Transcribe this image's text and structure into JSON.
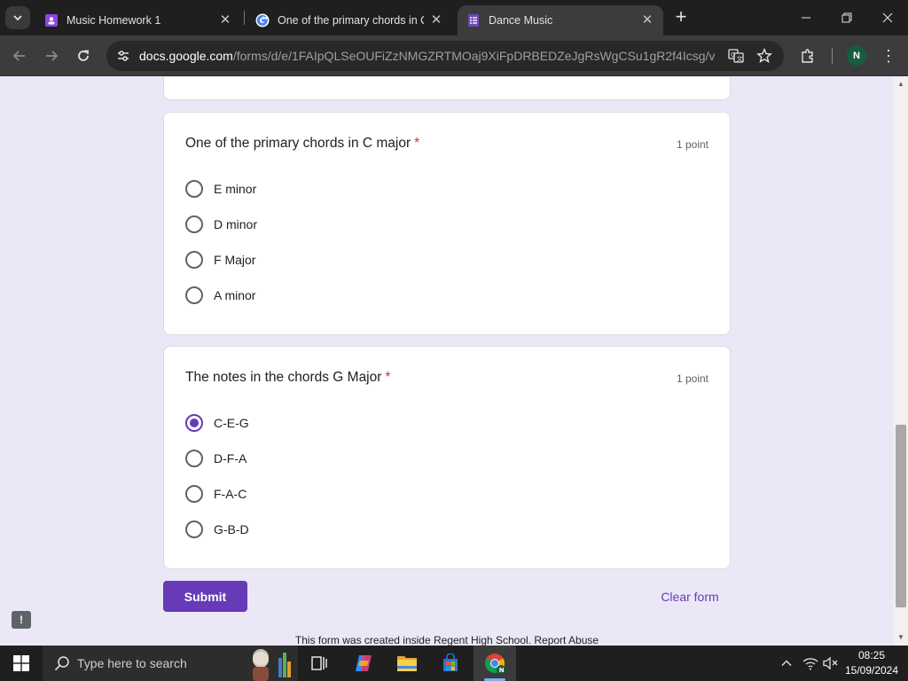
{
  "browser": {
    "tabs": [
      {
        "title": "Music Homework 1",
        "icon": "google-classroom-icon",
        "active": false
      },
      {
        "title": "One of the primary chords in C",
        "icon": "google-icon",
        "active": false
      },
      {
        "title": "Dance Music",
        "icon": "google-forms-icon",
        "active": true
      }
    ],
    "url_host": "docs.google.com",
    "url_path": "/forms/d/e/1FAIpQLSeOUFiZzNMGZRTMOaj9XiFpDRBEDZeJgRsWgCSu1gR2f4Icsg/viewf...",
    "profile_initial": "N",
    "colors": {
      "frame": "#1f1f1f",
      "toolbar": "#3c3c3c",
      "profile": "#155e3f"
    }
  },
  "form": {
    "accent_color": "#673ab7",
    "questions": [
      {
        "title": "One of the primary chords in C major",
        "required": "*",
        "points": "1 point",
        "options": [
          {
            "label": "E minor",
            "checked": false
          },
          {
            "label": "D minor",
            "checked": false
          },
          {
            "label": "F Major",
            "checked": false
          },
          {
            "label": "A minor",
            "checked": false
          }
        ]
      },
      {
        "title": "The notes in the chords G Major",
        "required": "*",
        "points": "1 point",
        "options": [
          {
            "label": "C-E-G",
            "checked": true
          },
          {
            "label": "D-F-A",
            "checked": false
          },
          {
            "label": "F-A-C",
            "checked": false
          },
          {
            "label": "G-B-D",
            "checked": false
          }
        ]
      }
    ],
    "submit_label": "Submit",
    "clear_label": "Clear form",
    "footer_text": "This form was created inside Regent High School. Report Abuse",
    "feedback_icon": "!"
  },
  "taskbar": {
    "search_placeholder": "Type here to search",
    "time": "08:25",
    "date": "15/09/2024",
    "chrome_badge": "N"
  }
}
